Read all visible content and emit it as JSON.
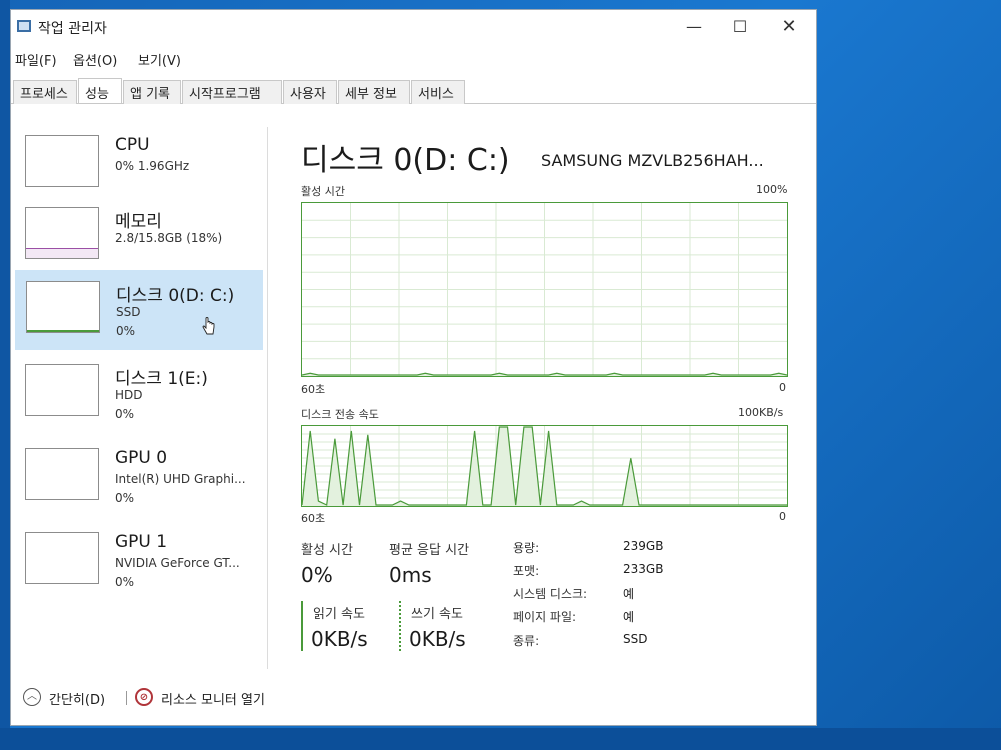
{
  "window": {
    "title": "작업 관리자",
    "min_glyph": "—",
    "max_glyph": "☐",
    "close_glyph": "✕"
  },
  "menu": [
    "파일(F)",
    "옵션(O)",
    "보기(V)"
  ],
  "tabs": [
    "프로세스",
    "성능",
    "앱 기록",
    "시작프로그램",
    "사용자",
    "세부 정보",
    "서비스"
  ],
  "active_tab": "성능",
  "sidebar": {
    "items": [
      {
        "title": "CPU",
        "sub": "0% 1.96GHz",
        "sub2": ""
      },
      {
        "title": "메모리",
        "sub": "2.8/15.8GB (18%)",
        "sub2": ""
      },
      {
        "title": "디스크 0(D: C:)",
        "sub": "SSD",
        "sub2": "0%"
      },
      {
        "title": "디스크 1(E:)",
        "sub": "HDD",
        "sub2": "0%"
      },
      {
        "title": "GPU 0",
        "sub": "Intel(R) UHD Graphi...",
        "sub2": "0%"
      },
      {
        "title": "GPU 1",
        "sub": "NVIDIA GeForce GT...",
        "sub2": "0%"
      }
    ],
    "selected_index": 2
  },
  "main": {
    "title": "디스크 0(D: C:)",
    "model": "SAMSUNG MZVLB256HAH...",
    "graph1": {
      "label": "활성 시간",
      "max_label": "100%",
      "time_label": "60초",
      "min_label": "0"
    },
    "graph2": {
      "label": "디스크 전송 속도",
      "max_label": "100KB/s",
      "time_label": "60초",
      "min_label": "0"
    },
    "stats": {
      "active_label": "활성 시간",
      "active_value": "0%",
      "response_label": "평균 응답 시간",
      "response_value": "0ms",
      "read_label": "읽기 속도",
      "read_value": "0KB/s",
      "write_label": "쓰기 속도",
      "write_value": "0KB/s"
    },
    "props": [
      {
        "label": "용량:",
        "value": "239GB"
      },
      {
        "label": "포맷:",
        "value": "233GB"
      },
      {
        "label": "시스템 디스크:",
        "value": "예"
      },
      {
        "label": "페이지 파일:",
        "value": "예"
      },
      {
        "label": "종류:",
        "value": "SSD"
      }
    ]
  },
  "footer": {
    "collapse_label": "간단히(D)",
    "resmon_label": "리소스 모니터 열기"
  },
  "colors": {
    "disk_accent": "#4a9a3a",
    "selection": "#cce4f7",
    "memory_accent": "#9b4fa5"
  },
  "icons": {
    "app": "task-manager-icon",
    "collapse": "chevron-up-circle-icon",
    "resmon": "resource-monitor-icon",
    "cursor": "hand-pointer-icon"
  },
  "chart_data": [
    {
      "type": "line",
      "title": "활성 시간",
      "x_range_label": "60초",
      "ylim": [
        0,
        100
      ],
      "y_unit": "%",
      "values": [
        0,
        1,
        0,
        0,
        0,
        0,
        0,
        0,
        0,
        0,
        0,
        0,
        0,
        0,
        0,
        1,
        0,
        0,
        0,
        0,
        0,
        0,
        0,
        0,
        1,
        0,
        0,
        0,
        0,
        0,
        0,
        1,
        0,
        0,
        0,
        0,
        0,
        0,
        1,
        0,
        0,
        0,
        0,
        0,
        0,
        0,
        0,
        0,
        0,
        0,
        1,
        0,
        0,
        0,
        0,
        0,
        0,
        0,
        1,
        0
      ]
    },
    {
      "type": "line",
      "title": "디스크 전송 속도",
      "x_range_label": "60초",
      "ylim": [
        0,
        100
      ],
      "y_unit": "KB/s",
      "values": [
        0,
        95,
        5,
        0,
        85,
        0,
        95,
        0,
        90,
        0,
        0,
        0,
        5,
        0,
        0,
        0,
        0,
        0,
        0,
        0,
        0,
        95,
        0,
        0,
        100,
        100,
        0,
        100,
        100,
        0,
        95,
        0,
        0,
        0,
        5,
        0,
        0,
        0,
        0,
        0,
        60,
        0,
        0,
        0,
        0,
        0,
        0,
        0,
        0,
        0,
        0,
        0,
        0,
        0,
        0,
        0,
        0,
        0,
        0,
        0
      ]
    }
  ]
}
